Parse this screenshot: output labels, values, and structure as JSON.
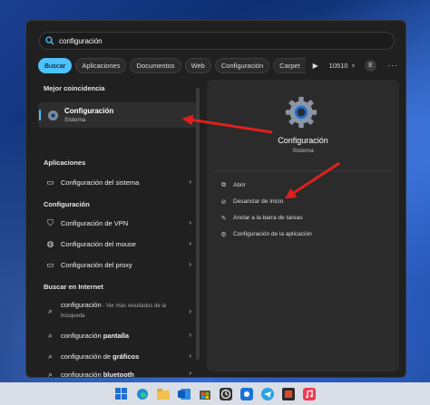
{
  "search": {
    "value": "configuración"
  },
  "filters": {
    "chips": [
      "Buscar",
      "Aplicaciones",
      "Documentos",
      "Web",
      "Configuración",
      "Carpet"
    ],
    "points": "10510",
    "avatar_letter": "E",
    "more": "···"
  },
  "left": {
    "best_match_header": "Mejor coincidencia",
    "best_match": {
      "title": "Configuración",
      "subtitle": "Sistema"
    },
    "apps_header": "Aplicaciones",
    "apps": [
      {
        "label": "Configuración del sistema",
        "icon": "monitor-icon"
      }
    ],
    "settings_header": "Configuración",
    "settings": [
      {
        "label": "Configuración de VPN",
        "icon": "shield-icon"
      },
      {
        "label": "Configuración del mouse",
        "icon": "mouse-icon"
      },
      {
        "label": "Configuración del proxy",
        "icon": "monitor-icon"
      }
    ],
    "web_header": "Buscar en Internet",
    "web": [
      {
        "prefix": "configuración",
        "bold": "",
        "sub": " - Ver más resultados de la búsqueda"
      },
      {
        "prefix": "configuración ",
        "bold": "pantalla",
        "sub": ""
      },
      {
        "prefix": "configuración de ",
        "bold": "gráficos",
        "sub": ""
      },
      {
        "prefix": "configuración ",
        "bold": "bluetooth",
        "sub": ""
      }
    ]
  },
  "right": {
    "title": "Configuración",
    "subtitle": "Sistema",
    "actions": [
      {
        "label": "Abrir",
        "icon": "open-icon"
      },
      {
        "label": "Desanclar de Inicio",
        "icon": "unpin-icon"
      },
      {
        "label": "Anclar a la barra de tareas",
        "icon": "pin-icon"
      },
      {
        "label": "Configuración de la aplicación",
        "icon": "gear-icon"
      }
    ]
  },
  "colors": {
    "accent": "#4cc2ff",
    "arrow": "#e0201c",
    "panel": "#202020",
    "pane": "#2b2b2b"
  },
  "taskbar": {
    "icons": [
      "windows-icon",
      "edge-icon",
      "folder-icon",
      "outlook-icon",
      "store-icon",
      "clock-icon",
      "photos-icon",
      "telegram-icon",
      "puzzle-icon",
      "music-icon"
    ]
  }
}
